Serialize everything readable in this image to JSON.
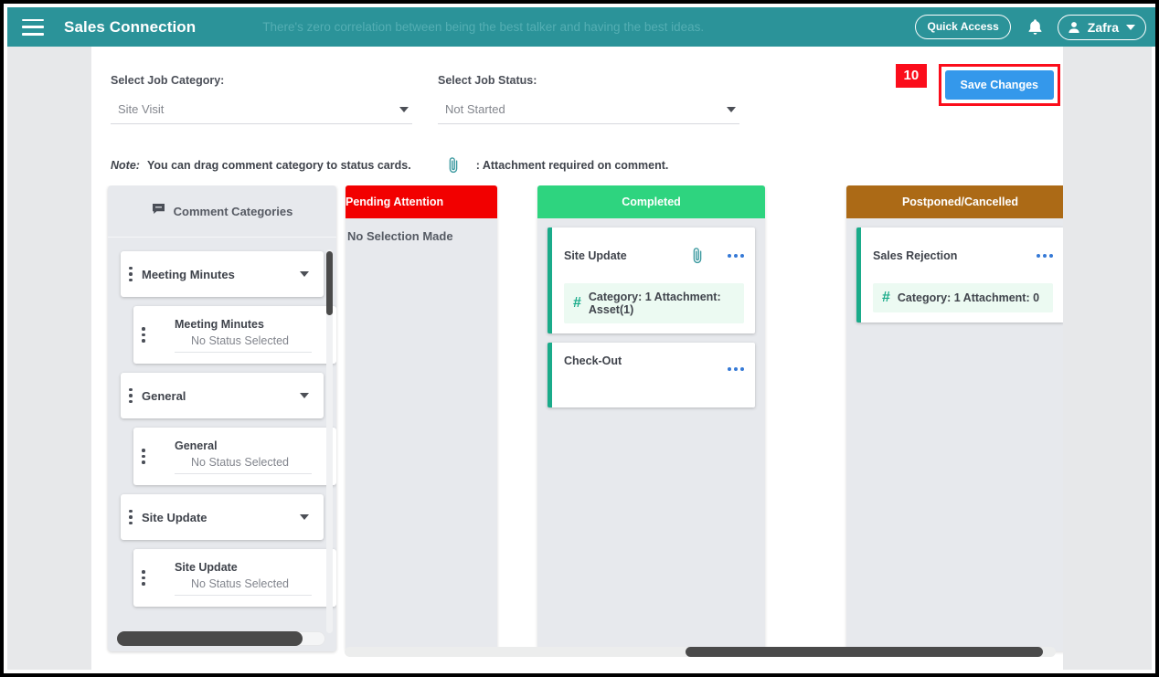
{
  "appbar": {
    "menu_icon": "hamburger-icon",
    "brand": "Sales Connection",
    "tagline": "There's zero correlation between being the best talker and having the best ideas.",
    "quick_access": "Quick Access",
    "bell_icon": "notification-bell-icon",
    "user_icon": "user-avatar-icon",
    "username": "Zafra",
    "caret_icon": "chevron-down-icon"
  },
  "filters": {
    "category": {
      "label": "Select Job Category:",
      "value": "Site Visit"
    },
    "status": {
      "label": "Select Job Status:",
      "value": "Not Started"
    }
  },
  "note": {
    "prefix": "Note:",
    "text": "You can drag comment category to status cards.",
    "clip_icon": "paperclip-icon",
    "attachment_text": ": Attachment required on comment."
  },
  "save": {
    "badge": "10",
    "label": "Save Changes",
    "highlight_color": "#fb0d1b",
    "button_color": "#3498eb"
  },
  "categories_panel": {
    "icon": "comment-bubble-icon",
    "title": "Comment Categories",
    "items": [
      {
        "name": "Meeting Minutes",
        "sub_title": "Meeting Minutes",
        "sub_status": "No Status Selected"
      },
      {
        "name": "General",
        "sub_title": "General",
        "sub_status": "No Status Selected"
      },
      {
        "name": "Site Update",
        "sub_title": "Site Update",
        "sub_status": "No Status Selected"
      }
    ]
  },
  "columns": [
    {
      "title": "Pending Attention",
      "color": "#f20000",
      "empty_message": "No Selection Made",
      "cards": []
    },
    {
      "title": "Completed",
      "color": "#2ed47f",
      "empty_message": "",
      "cards": [
        {
          "title": "Site Update",
          "has_attachment": true,
          "clip_icon": "paperclip-icon",
          "meta_icon": "hash-icon",
          "meta": "Category: 1 Attachment: Asset(1)",
          "menu_icon": "more-options-icon"
        },
        {
          "title": "Check-Out",
          "has_attachment": false,
          "clip_icon": "",
          "meta_icon": "",
          "meta": "",
          "menu_icon": "more-options-icon"
        }
      ]
    },
    {
      "title": "Postponed/Cancelled",
      "color": "#ac6a16",
      "empty_message": "",
      "cards": [
        {
          "title": "Sales Rejection",
          "has_attachment": false,
          "clip_icon": "",
          "meta_icon": "hash-icon",
          "meta": "Category: 1 Attachment: 0",
          "menu_icon": "more-options-icon"
        }
      ]
    }
  ]
}
